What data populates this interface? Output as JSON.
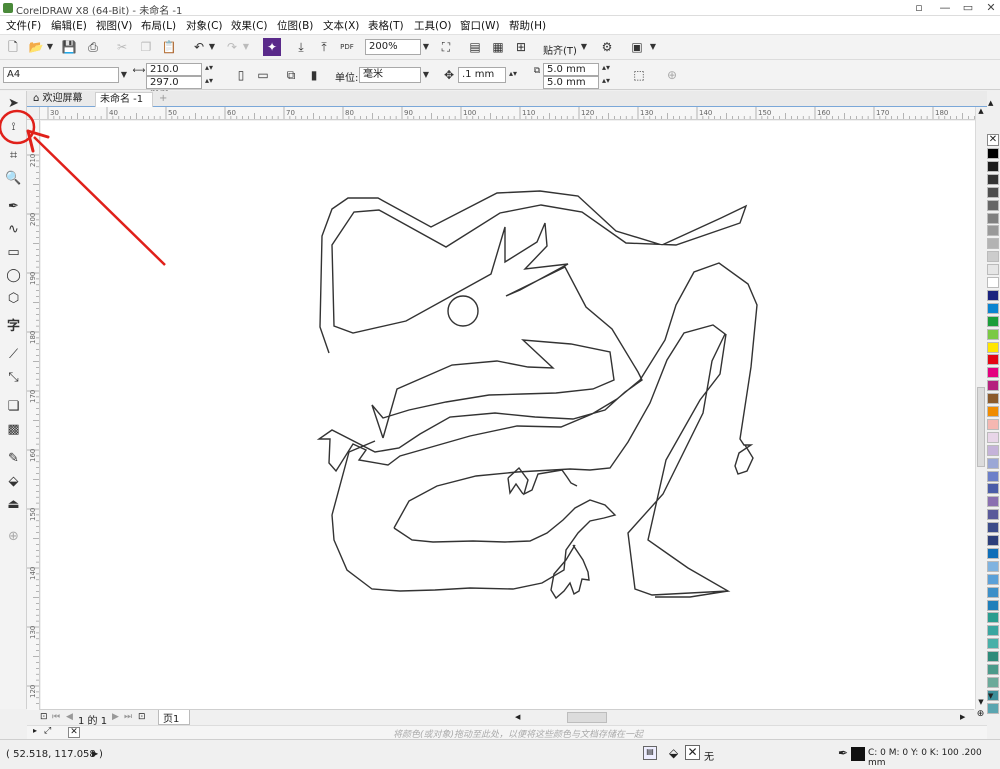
{
  "app": {
    "title": "CorelDRAW X8 (64-Bit) - 未命名 -1"
  },
  "menu": [
    "文件(F)",
    "编辑(E)",
    "视图(V)",
    "布局(L)",
    "对象(C)",
    "效果(C)",
    "位图(B)",
    "文本(X)",
    "表格(T)",
    "工具(O)",
    "窗口(W)",
    "帮助(H)"
  ],
  "standard_toolbar": {
    "zoom_value": "200%",
    "snap_label": "贴齐(T)",
    "pdf_label": "PDF"
  },
  "property_bar": {
    "page_size": "A4",
    "width": "210.0 mm",
    "height": "297.0 mm",
    "unit_label": "单位:",
    "unit_value": "毫米",
    "nudge": ".1 mm",
    "dup_x": "5.0 mm",
    "dup_y": "5.0 mm"
  },
  "tabs": [
    {
      "label": "欢迎屏幕",
      "active": false
    },
    {
      "label": "未命名 -1",
      "active": true
    }
  ],
  "rulers": {
    "horizontal_ticks": [
      "30",
      "40",
      "50",
      "60",
      "70",
      "80",
      "90",
      "100",
      "110",
      "120",
      "130",
      "140",
      "150",
      "160",
      "170",
      "180"
    ],
    "vertical_ticks": [
      "210",
      "200",
      "190",
      "180",
      "170",
      "160",
      "150",
      "140",
      "130",
      "120"
    ],
    "unit": "毫米"
  },
  "page_nav": {
    "page_text": "1 的 1",
    "page_tab": "页1"
  },
  "doc_palette_hint": "将颜色(或对象)拖动至此处，以便将这些颜色与文档存储在一起",
  "status": {
    "coordinates": "( 52.518, 117.058 )",
    "fill_label": "无",
    "outline_info": "C: 0 M: 0 Y: 0 K: 100  .200 mm"
  },
  "palette_colors": [
    "#ffffff",
    "#000000",
    "#1a1a1a",
    "#333333",
    "#4d4d4d",
    "#666666",
    "#808080",
    "#999999",
    "#b3b3b3",
    "#cccccc",
    "#e6e6e6",
    "#ffffff",
    "#1a237e",
    "#0a84d0",
    "#1b9e3a",
    "#7ac943",
    "#ffe600",
    "#e30613",
    "#e4007f",
    "#b5217e",
    "#8b5a2b",
    "#f08c00",
    "#f5b7b1",
    "#e8d5e8",
    "#c5b3d9",
    "#9aa7d6",
    "#6c7fc9",
    "#4a5ca8",
    "#8a6fb0",
    "#5a5a9a",
    "#3b4b8a",
    "#2c3e7a",
    "#0e6eb8",
    "#7fb3e0",
    "#5aa0d8",
    "#3c8fc8",
    "#1f7fba",
    "#2a9d8f",
    "#3aa6a0",
    "#48b0a8",
    "#2e8b7a",
    "#4a9a8a",
    "#6aaa9a",
    "#3d8f9a",
    "#5aa5b0"
  ],
  "colors": {
    "accent_blue": "#7aa7d8",
    "annotation_red": "#e0201a"
  }
}
